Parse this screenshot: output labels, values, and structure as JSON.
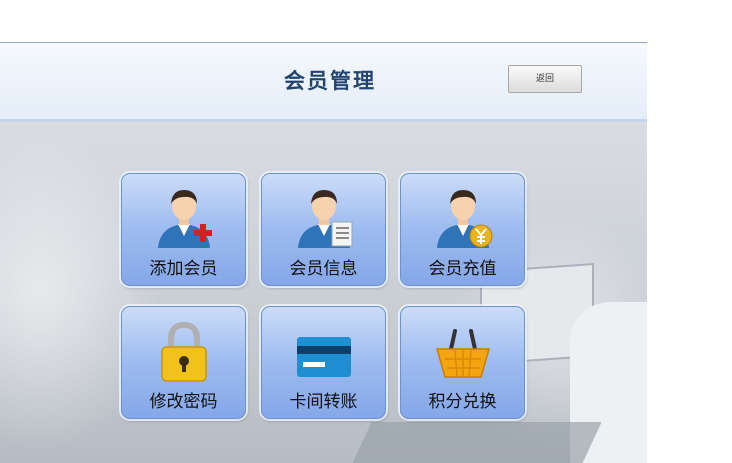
{
  "header": {
    "title": "会员管理",
    "back_label": "返回"
  },
  "tiles": [
    {
      "label": "添加会员",
      "icon": "person-add-icon"
    },
    {
      "label": "会员信息",
      "icon": "person-info-icon"
    },
    {
      "label": "会员充值",
      "icon": "person-recharge-icon"
    },
    {
      "label": "修改密码",
      "icon": "padlock-icon"
    },
    {
      "label": "卡间转账",
      "icon": "credit-card-icon"
    },
    {
      "label": "积分兑换",
      "icon": "basket-icon"
    }
  ],
  "colors": {
    "header_text": "#22456f",
    "tile_top": "#ccdcf8",
    "tile_bottom": "#85a7e8"
  }
}
